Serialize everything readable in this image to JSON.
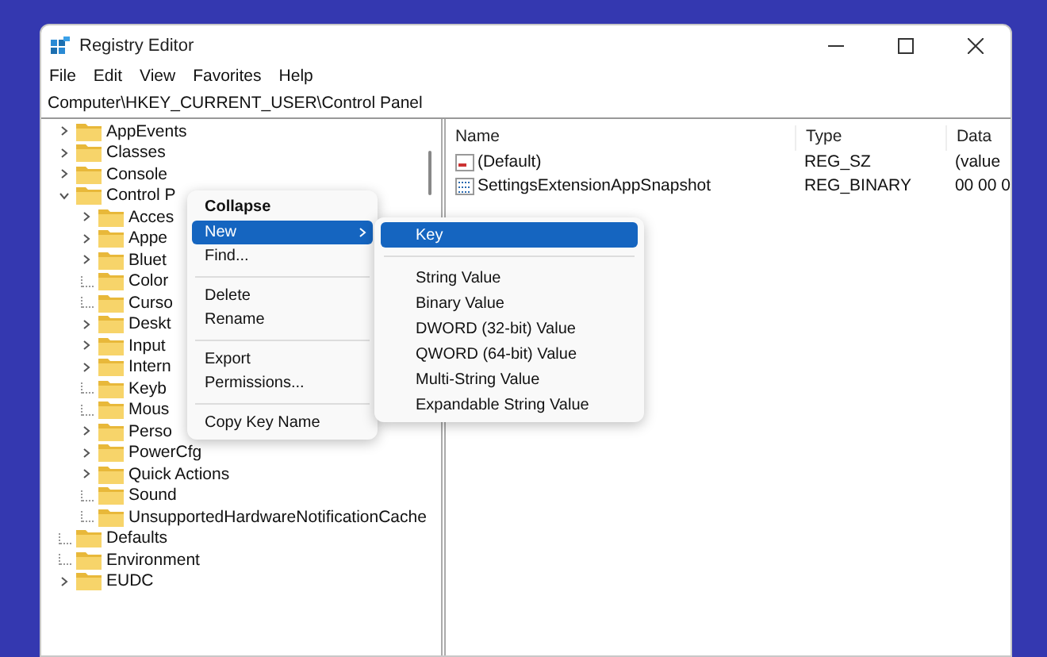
{
  "window": {
    "title": "Registry Editor"
  },
  "menu_bar": [
    "File",
    "Edit",
    "View",
    "Favorites",
    "Help"
  ],
  "address": "Computer\\HKEY_CURRENT_USER\\Control Panel",
  "tree": [
    {
      "label": "AppEvents",
      "has_children": true,
      "expanded": false
    },
    {
      "label": "Classes",
      "has_children": true,
      "expanded": false
    },
    {
      "label": "Console",
      "has_children": true,
      "expanded": false
    },
    {
      "label": "Control P",
      "has_children": true,
      "expanded": true,
      "children": [
        {
          "label": "Acces",
          "has_children": true,
          "expanded": false
        },
        {
          "label": "Appe",
          "has_children": true,
          "expanded": false
        },
        {
          "label": "Bluet",
          "has_children": true,
          "expanded": false
        },
        {
          "label": "Color",
          "has_children": false
        },
        {
          "label": "Curso",
          "has_children": false
        },
        {
          "label": "Deskt",
          "has_children": true,
          "expanded": false
        },
        {
          "label": "Input",
          "has_children": true,
          "expanded": false
        },
        {
          "label": "Intern",
          "has_children": true,
          "expanded": false
        },
        {
          "label": "Keyb",
          "has_children": false
        },
        {
          "label": "Mous",
          "has_children": false
        },
        {
          "label": "Perso",
          "has_children": true,
          "expanded": false
        },
        {
          "label": "PowerCfg",
          "has_children": true,
          "expanded": false
        },
        {
          "label": "Quick Actions",
          "has_children": true,
          "expanded": false
        },
        {
          "label": "Sound",
          "has_children": false
        },
        {
          "label": "UnsupportedHardwareNotificationCache",
          "has_children": false
        }
      ]
    },
    {
      "label": "Defaults",
      "has_children": false
    },
    {
      "label": "Environment",
      "has_children": false
    },
    {
      "label": "EUDC",
      "has_children": true,
      "expanded": false
    }
  ],
  "values_table": {
    "columns": [
      "Name",
      "Type",
      "Data"
    ],
    "rows": [
      {
        "kind": "string",
        "name": "(Default)",
        "type": "REG_SZ",
        "data": "(value"
      },
      {
        "kind": "binary",
        "name": "SettingsExtensionAppSnapshot",
        "type": "REG_BINARY",
        "data": "00 00 0"
      }
    ]
  },
  "context_menu": [
    {
      "kind": "item",
      "label": "Collapse",
      "default": true,
      "selected": false,
      "submenu": false
    },
    {
      "kind": "item",
      "label": "New",
      "default": false,
      "selected": true,
      "submenu": true
    },
    {
      "kind": "item",
      "label": "Find...",
      "default": false,
      "selected": false,
      "submenu": false
    },
    {
      "kind": "separator"
    },
    {
      "kind": "item",
      "label": "Delete",
      "default": false,
      "selected": false,
      "submenu": false
    },
    {
      "kind": "item",
      "label": "Rename",
      "default": false,
      "selected": false,
      "submenu": false
    },
    {
      "kind": "separator"
    },
    {
      "kind": "item",
      "label": "Export",
      "default": false,
      "selected": false,
      "submenu": false
    },
    {
      "kind": "item",
      "label": "Permissions...",
      "default": false,
      "selected": false,
      "submenu": false
    },
    {
      "kind": "separator"
    },
    {
      "kind": "item",
      "label": "Copy Key Name",
      "default": false,
      "selected": false,
      "submenu": false
    }
  ],
  "new_submenu": [
    {
      "kind": "item",
      "label": "Key",
      "selected": true
    },
    {
      "kind": "separator"
    },
    {
      "kind": "item",
      "label": "String Value",
      "selected": false
    },
    {
      "kind": "item",
      "label": "Binary Value",
      "selected": false
    },
    {
      "kind": "item",
      "label": "DWORD (32-bit) Value",
      "selected": false
    },
    {
      "kind": "item",
      "label": "QWORD (64-bit) Value",
      "selected": false
    },
    {
      "kind": "item",
      "label": "Multi-String Value",
      "selected": false
    },
    {
      "kind": "item",
      "label": "Expandable String Value",
      "selected": false
    }
  ]
}
